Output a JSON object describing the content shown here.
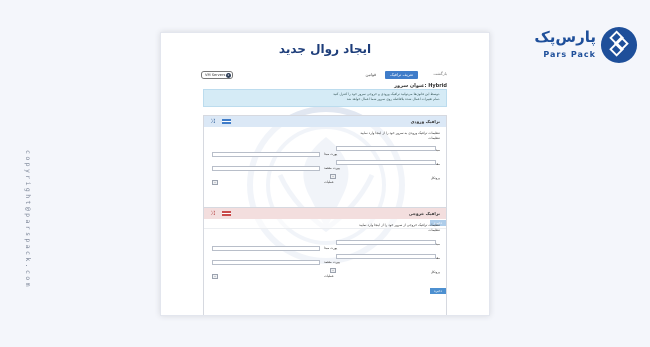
{
  "brand": {
    "name_fa": "پارس‌پک",
    "name_en": "Pars Pack",
    "side_text": "copyright@parspack.com",
    "icon": "diamond-logo-icon",
    "color": "#1e4f9a"
  },
  "page": {
    "title": "ایجاد روال جدید",
    "server_label": "عنوان سرور: Hybrid"
  },
  "toolbar": {
    "breadcrumb_root": "بازگشت",
    "active_chip": "تعریف ترافیک",
    "chip": "قوانین",
    "vm_pill": "VM Servers",
    "vm_count": "2"
  },
  "info": {
    "lines": [
      "توسط این قانون‌ها می‌توانید ترافیک ورودی و خروجی سرور خود را کنترل کنید.",
      "تمام تغییرات اعمال شده بلافاصله روی سرور شما اعمال خواهد شد."
    ],
    "color": "#d5ebf6"
  },
  "panels": [
    {
      "title": "ترافیک ورودی",
      "icon": "shuffle-icon",
      "description": "تنظیمات ترافیک ورودی به سرور خود را از اینجا وارد نمایید",
      "sub_label": "تنظیمات",
      "fields": {
        "ip_source": "IP مبدا",
        "ip_dest": "IP مقصد",
        "port_source": "پورت مبدا",
        "port_dest": "پورت مقصد",
        "protocol": "پروتکل",
        "action": "عملیات"
      },
      "save": "ذخیره",
      "accent": "#3f7cc9"
    },
    {
      "title": "ترافیک خروجی",
      "icon": "shuffle-icon",
      "description": "تنظیمات ترافیک خروجی از سرور خود را از اینجا وارد نمایید",
      "sub_label": "تنظیمات",
      "fields": {
        "ip_source": "IP مبدا",
        "ip_dest": "IP مقصد",
        "port_source": "پورت مبدا",
        "port_dest": "پورت مقصد",
        "protocol": "پروتکل",
        "action": "عملیات"
      },
      "save": "ذخیره",
      "accent": "#c94a4a"
    }
  ]
}
